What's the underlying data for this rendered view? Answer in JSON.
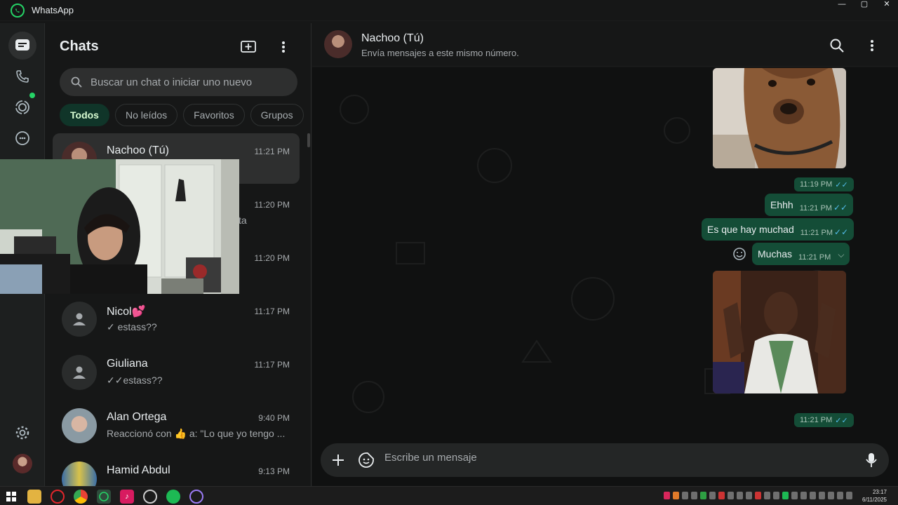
{
  "window": {
    "title": "WhatsApp",
    "minimize": "—",
    "maximize": "▢",
    "close": "✕"
  },
  "rail": {
    "items": [
      {
        "icon": "chats-icon"
      },
      {
        "icon": "calls-icon"
      },
      {
        "icon": "status-icon"
      },
      {
        "icon": "meta-ai-icon"
      },
      {
        "icon": "settings-icon"
      },
      {
        "icon": "profile-avatar"
      }
    ],
    "status_dot_color": "#25d366"
  },
  "sidebar": {
    "title": "Chats",
    "search_placeholder": "Buscar un chat o iniciar uno nuevo",
    "filters": [
      "Todos",
      "No leídos",
      "Favoritos",
      "Grupos"
    ],
    "chats": [
      {
        "name": "Nachoo (Tú)",
        "time": "11:21 PM",
        "preview": ""
      },
      {
        "name": "",
        "time": "11:20 PM",
        "preview": "ta"
      },
      {
        "name": "",
        "time": "11:20 PM",
        "preview": ""
      },
      {
        "name": "Nicol💕",
        "time": "11:17 PM",
        "preview": "✓ estass??"
      },
      {
        "name": "Giuliana",
        "time": "11:17 PM",
        "preview": "✓✓estass??"
      },
      {
        "name": "Alan Ortega",
        "time": "9:40 PM",
        "preview": "Reaccionó con 👍 a: \"Lo que yo tengo ..."
      },
      {
        "name": "Hamid Abdul",
        "time": "9:13 PM",
        "preview": ""
      }
    ]
  },
  "header": {
    "name": "Nachoo (Tú)",
    "subtitle": "Envía mensajes a este mismo número."
  },
  "messages": [
    {
      "type": "image",
      "subject": "dog photo"
    },
    {
      "type": "time",
      "time": "11:19 PM"
    },
    {
      "type": "text",
      "text": "Ehhh",
      "time": "11:21 PM"
    },
    {
      "type": "text",
      "text": "Es que hay muchad",
      "time": "11:21 PM"
    },
    {
      "type": "text",
      "text": "Muchas",
      "time": "11:21 PM"
    },
    {
      "type": "image",
      "subject": "man gesturing"
    },
    {
      "type": "time",
      "time": "11:21 PM"
    }
  ],
  "composer": {
    "placeholder": "Escribe un mensaje"
  },
  "taskbar": {
    "time": "23:17",
    "date": "6/11/2025"
  },
  "colors": {
    "accent": "#25d366",
    "bubble_out": "#144d37",
    "read_check": "#53bdeb",
    "background": "#161717"
  }
}
